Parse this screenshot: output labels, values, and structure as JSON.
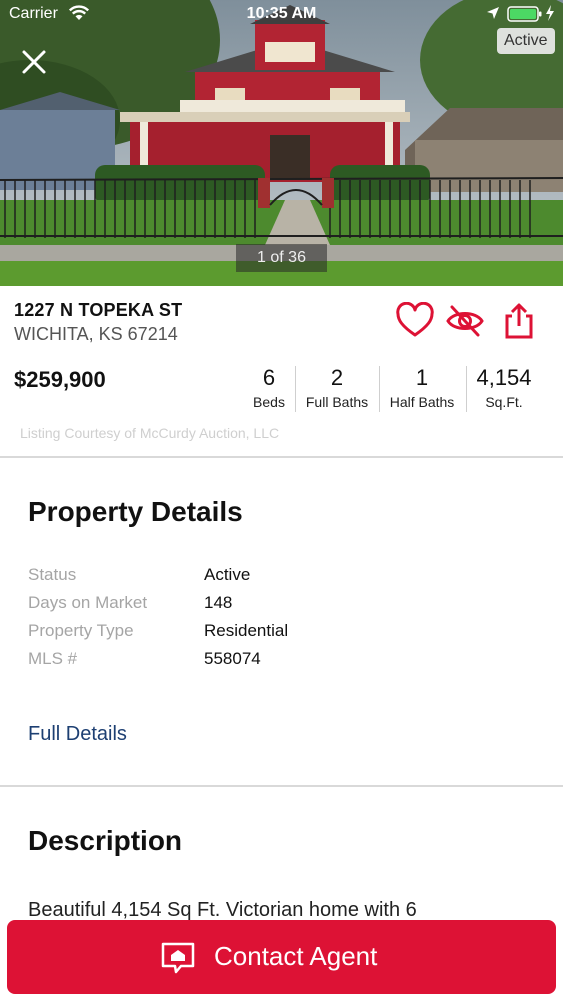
{
  "status_bar": {
    "carrier": "Carrier",
    "time": "10:35 AM"
  },
  "gallery": {
    "status_badge": "Active",
    "counter": "1 of 36"
  },
  "listing": {
    "street": "1227 N TOPEKA ST",
    "city": "WICHITA, KS 67214",
    "price": "$259,900",
    "courtesy": "Listing Courtesy of McCurdy Auction, LLC",
    "stats": [
      {
        "value": "6",
        "label": "Beds"
      },
      {
        "value": "2",
        "label": "Full Baths"
      },
      {
        "value": "1",
        "label": "Half Baths"
      },
      {
        "value": "4,154",
        "label": "Sq.Ft."
      }
    ]
  },
  "property_details": {
    "title": "Property Details",
    "rows": [
      {
        "key": "Status",
        "value": "Active"
      },
      {
        "key": "Days on Market",
        "value": "148"
      },
      {
        "key": "Property Type",
        "value": "Residential"
      },
      {
        "key": "MLS #",
        "value": "558074"
      }
    ],
    "full_details_link": "Full Details"
  },
  "description": {
    "title": "Description",
    "text": "Beautiful 4,154 Sq Ft. Victorian home with 6"
  },
  "contact": {
    "label": "Contact Agent"
  },
  "icons": {
    "close": "close-icon",
    "favorite": "heart-icon",
    "hide": "eye-slash-icon",
    "share": "share-icon",
    "contact": "house-chat-icon"
  },
  "colors": {
    "accent": "#dd1235",
    "link": "#1d3f72",
    "muted": "#a5a5a5"
  }
}
